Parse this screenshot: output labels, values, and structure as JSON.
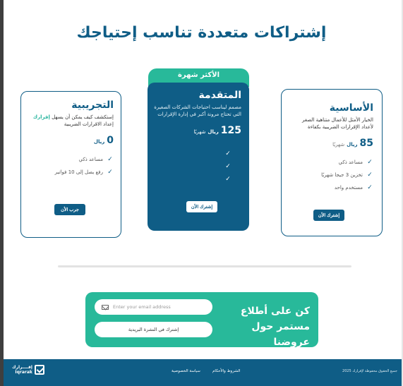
{
  "page": {
    "title": "إشتراكات متعددة تناسب إحتياجك"
  },
  "plans": {
    "basic": {
      "name": "الأساسية",
      "desc": "الخيار الأمثل للأعمال متناهية الصغر لأعداد الإقرارات الضريبية بكفاءة",
      "price": "85",
      "currency": "ريال",
      "period": "شهريًا",
      "features": [
        "مساعد ذكي",
        "تخزين 3 جيجا شهريًا",
        "مستخدم واحد"
      ],
      "button": "إشترك الأن"
    },
    "featured": {
      "badge": "الأكثر شهرة",
      "name": "المتقدمة",
      "desc": "مصمم ليناسب احتياجات الشركات الصغيرة التي تحتاج مرونة أكبر في إدارة الإقرارات",
      "price": "125",
      "currency": "ريال",
      "period": "شهريًا",
      "button": "إشترك الأن"
    },
    "trial": {
      "name": "التجريبية",
      "desc_prefix": "إستكشف كيف يمكن أن يسهل",
      "desc_brand": "إقرارك",
      "desc_suffix": "إعداد الاقرارات الضريبية",
      "price": "0",
      "currency": "ريال",
      "features": [
        "مساعد ذكي",
        "رفع يصل إلى 10 فواتير"
      ],
      "button": "جرب الأن"
    }
  },
  "newsletter": {
    "line1": "كن على أطلاع",
    "line2": "مستمر حول عروضنا",
    "email_placeholder": "Enter your email address",
    "button": "إشترك في النشرة البريدية"
  },
  "footer": {
    "logo_ar": "إقــــرارك",
    "logo_en": "Iqrarak",
    "terms": "الشروط والأحكام",
    "privacy": "سياسة الخصوصية",
    "copyright": "جميع الحقوق محفوظة لإقرارك 2025"
  },
  "colors": {
    "primary": "#0f5d86",
    "accent": "#28b99a"
  }
}
